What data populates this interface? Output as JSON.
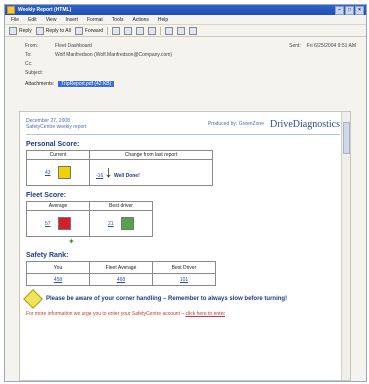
{
  "window": {
    "title": "Weekly Report (HTML)",
    "controls": [
      "–",
      "□",
      "×"
    ]
  },
  "menu": [
    "File",
    "Edit",
    "View",
    "Insert",
    "Format",
    "Tools",
    "Actions",
    "Help"
  ],
  "toolbar": {
    "buttons": [
      "Reply",
      "Reply to All",
      "Forward"
    ]
  },
  "header": {
    "from_label": "From:",
    "from_value": "Fleet Dashboard",
    "sent_label": "Sent:",
    "sent_value": "Fri 6/25/2004 9:51 AM",
    "to_label": "To:",
    "to_value": "Wolf Manfredson (Wolf.Manfredson@Company.com)",
    "cc_label": "Cc:",
    "subject_label": "Subject:",
    "attachments_label": "Attachments:",
    "attachment_file": "TripReport.pdf (42 KB)"
  },
  "email": {
    "date": "December 27, 2008",
    "subtitle": "SafetyCentre weekly report",
    "produced_by": "Produced by: GreenZone",
    "brand": "DriveDiagnostics",
    "personal_title": "Personal Score:",
    "personal_headers": [
      "Current",
      "Change from last report"
    ],
    "current_score": "43",
    "change_score": "-16",
    "change_note": "Well Done!",
    "fleet_title": "Fleet Score:",
    "fleet_headers": [
      "Average",
      "Best driver"
    ],
    "fleet_average": "57",
    "fleet_best": "21",
    "safety_title": "Safety Rank:",
    "rank_headers": [
      "You",
      "Fleet Average",
      "Best Driver"
    ],
    "rank_values": [
      "458",
      "468",
      "101"
    ],
    "tip_text": "Please be aware of your corner handling – Remember to always slow before turning!",
    "footer_text": "For more information we urge you to enter your SafetyCentre account –",
    "footer_link": "click here to enter"
  },
  "colors": {
    "current_tile": "#f2d100",
    "average_tile": "#d41f2a",
    "best_tile": "#54a24a"
  }
}
